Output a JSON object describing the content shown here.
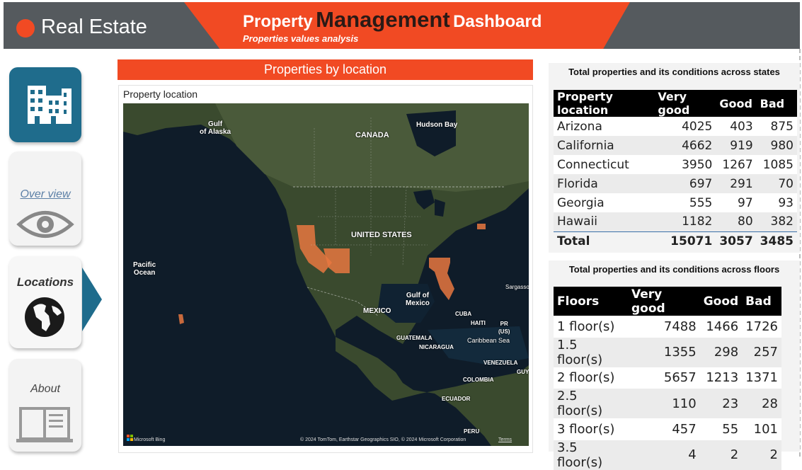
{
  "header": {
    "brand": "Real Estate",
    "title_part1": "Property",
    "title_part2": "Management",
    "title_part3": "Dashboard",
    "subtitle": "Properties values analysis"
  },
  "nav": {
    "overview_label": "Over view",
    "locations_label": "Locations",
    "about_label": "About"
  },
  "map_section": {
    "title": "Properties by location",
    "visual_label": "Property location",
    "labels": {
      "gulf_of_alaska": "Gulf\nof Alaska",
      "canada": "CANADA",
      "hudson_bay": "Hudson Bay",
      "united_states": "UNITED STATES",
      "pacific_ocean": "Pacific\nOcean",
      "gulf_of_mexico": "Gulf of\nMexico",
      "mexico": "MEXICO",
      "cuba": "CUBA",
      "haiti": "HAITI",
      "pr": "PR\n(US)",
      "caribbean_sea": "Caribbean Sea",
      "guatemala": "GUATEMALA",
      "nicaragua": "NICARAGUA",
      "venezuela": "VENEZUELA",
      "colombia": "COLOMBIA",
      "ecuador": "ECUADOR",
      "peru": "PERU",
      "sargasso": "Sargasso",
      "guy": "GUY"
    },
    "attribution_left": "Microsoft Bing",
    "attribution_right": "© 2024 TomTom, Earthstar Geographics SIO, © 2024 Microsoft Corporation",
    "terms": "Terms"
  },
  "table_states": {
    "caption": "Total properties and its conditions across states",
    "headers": [
      "Property location",
      "Very good",
      "Good",
      "Bad"
    ],
    "rows": [
      [
        "Arizona",
        "4025",
        "403",
        "875"
      ],
      [
        "California",
        "4662",
        "919",
        "980"
      ],
      [
        "Connecticut",
        "3950",
        "1267",
        "1085"
      ],
      [
        "Florida",
        "697",
        "291",
        "70"
      ],
      [
        "Georgia",
        "555",
        "97",
        "93"
      ],
      [
        "Hawaii",
        "1182",
        "80",
        "382"
      ]
    ],
    "total": [
      "Total",
      "15071",
      "3057",
      "3485"
    ]
  },
  "table_floors": {
    "caption": "Total properties and its conditions across floors",
    "headers": [
      "Floors",
      "Very good",
      "Good",
      "Bad"
    ],
    "rows": [
      [
        "1 floor(s)",
        "7488",
        "1466",
        "1726"
      ],
      [
        "1.5 floor(s)",
        "1355",
        "298",
        "257"
      ],
      [
        "2 floor(s)",
        "5657",
        "1213",
        "1371"
      ],
      [
        "2.5 floor(s)",
        "110",
        "23",
        "28"
      ],
      [
        "3 floor(s)",
        "457",
        "55",
        "101"
      ],
      [
        "3.5 floor(s)",
        "4",
        "2",
        "2"
      ]
    ]
  },
  "colors": {
    "accent": "#f14a23",
    "header_bg": "#555a5e",
    "nav_active": "#1f6c8c",
    "highlight_state": "#e8773f"
  },
  "icons": [
    "buildings-icon",
    "eye-icon",
    "globe-icon",
    "book-icon"
  ]
}
